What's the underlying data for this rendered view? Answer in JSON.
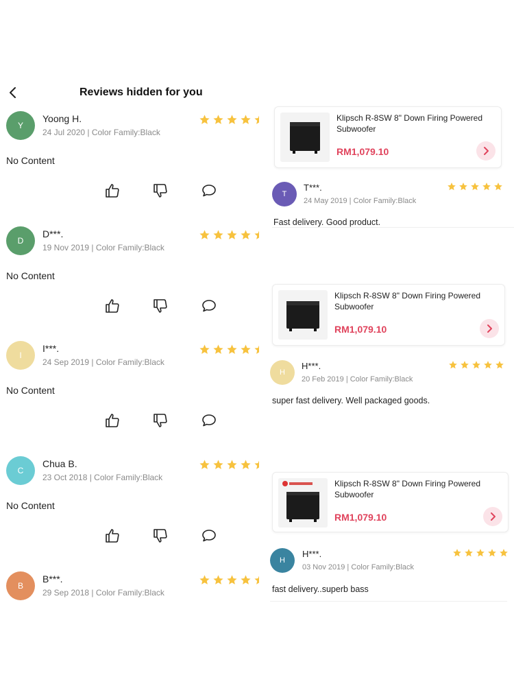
{
  "header": {
    "title": "Reviews hidden for you"
  },
  "colors": {
    "star": "#f7c23e",
    "price": "#e0435c",
    "meta": "#8a8a8a"
  },
  "left_reviews": [
    {
      "initial": "Y",
      "name": "Yoong H.",
      "meta": "24 Jul 2020 | Color Family:Black",
      "content": "No Content",
      "avatar_color": "#5a9e6b",
      "rating": 5
    },
    {
      "initial": "D",
      "name": "D***.",
      "meta": "19 Nov 2019 | Color Family:Black",
      "content": "No Content",
      "avatar_color": "#5a9e6b",
      "rating": 5
    },
    {
      "initial": "I",
      "name": "I***.",
      "meta": "24 Sep 2019 | Color Family:Black",
      "content": "No Content",
      "avatar_color": "#efdc9e",
      "rating": 5
    },
    {
      "initial": "C",
      "name": "Chua B.",
      "meta": "23 Oct 2018 | Color Family:Black",
      "content": "No Content",
      "avatar_color": "#6bccd4",
      "rating": 5
    },
    {
      "initial": "B",
      "name": "B***.",
      "meta": "29 Sep 2018 | Color Family:Black",
      "avatar_color": "#e38f5e",
      "rating": 5
    }
  ],
  "right_reviews": [
    {
      "product_title": "Klipsch R-8SW 8\" Down Firing Powered Subwoofer",
      "price": "RM1,079.10",
      "initial": "T",
      "name": "T***.",
      "meta": "24 May 2019 | Color Family:Black",
      "content": "Fast delivery. Good product.",
      "avatar_color": "#6a5bb5",
      "rating": 5
    },
    {
      "product_title": "Klipsch R-8SW 8\" Down Firing Powered Subwoofer",
      "price": "RM1,079.10",
      "initial": "H",
      "name": "H***.",
      "meta": "20 Feb 2019 | Color Family:Black",
      "content": "super fast delivery. Well packaged goods.",
      "avatar_color": "#efdc9e",
      "rating": 5
    },
    {
      "product_title": "Klipsch R-8SW 8\" Down Firing Powered Subwoofer",
      "price": "RM1,079.10",
      "initial": "H",
      "name": "H***.",
      "meta": "03 Nov 2019 | Color Family:Black",
      "content": "fast delivery..superb bass",
      "avatar_color": "#3a84a0",
      "rating": 5
    }
  ]
}
